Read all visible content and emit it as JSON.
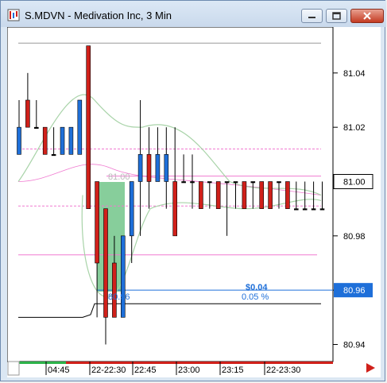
{
  "window": {
    "title": "S.MDVN - Medivation Inc, 3 Min",
    "minimize_icon": "minimize-icon",
    "restore_icon": "restore-icon",
    "close_icon": "close-icon"
  },
  "colors": {
    "bull": "#1e6fd9",
    "bear": "#d0201a",
    "neutral": "#000000",
    "price_marker_bg": "#1e6fd9",
    "band": "#a8d3a8",
    "zone": "#5fbe7a",
    "pink": "#f07ad0"
  },
  "price_axis": {
    "ticks": [
      "81.04",
      "81.02",
      "81.00",
      "80.98",
      "80.96",
      "80.94"
    ],
    "current_price": "81.00",
    "marker_price": "80.96"
  },
  "time_axis": {
    "labels": [
      "04:45",
      "22-22:30",
      "22:45",
      "23:00",
      "23:15",
      "22-23:30"
    ]
  },
  "annotations": {
    "price_change": "$0.04",
    "percent_change": "0.05 %",
    "zone_low_label": "80.96",
    "zone_high_label": "81.00"
  },
  "chart_data": {
    "type": "ohlc",
    "y_range": [
      80.934,
      81.054
    ],
    "bars": [
      {
        "o": 81.01,
        "h": 81.03,
        "l": 81.01,
        "c": 81.02
      },
      {
        "o": 81.03,
        "h": 81.04,
        "l": 81.02,
        "c": 81.02
      },
      {
        "o": 81.02,
        "h": 81.03,
        "l": 81.02,
        "c": 81.02
      },
      {
        "o": 81.02,
        "h": 81.02,
        "l": 81.01,
        "c": 81.01
      },
      {
        "o": 81.01,
        "h": 81.02,
        "l": 81.01,
        "c": 81.01
      },
      {
        "o": 81.01,
        "h": 81.02,
        "l": 81.01,
        "c": 81.02
      },
      {
        "o": 81.01,
        "h": 81.02,
        "l": 81.01,
        "c": 81.02
      },
      {
        "o": 81.01,
        "h": 81.03,
        "l": 81.01,
        "c": 81.03
      },
      {
        "o": 81.05,
        "h": 81.05,
        "l": 81.0,
        "c": 80.99
      },
      {
        "o": 81.0,
        "h": 81.0,
        "l": 80.95,
        "c": 80.97
      },
      {
        "o": 80.99,
        "h": 80.99,
        "l": 80.94,
        "c": 80.95
      },
      {
        "o": 80.97,
        "h": 80.98,
        "l": 80.95,
        "c": 80.95
      },
      {
        "o": 80.95,
        "h": 80.98,
        "l": 80.95,
        "c": 80.98
      },
      {
        "o": 80.98,
        "h": 81.0,
        "l": 80.97,
        "c": 81.0
      },
      {
        "o": 81.0,
        "h": 81.03,
        "l": 80.98,
        "c": 81.01
      },
      {
        "o": 81.01,
        "h": 81.02,
        "l": 80.99,
        "c": 81.0
      },
      {
        "o": 81.0,
        "h": 81.02,
        "l": 81.0,
        "c": 81.01
      },
      {
        "o": 81.0,
        "h": 81.02,
        "l": 80.99,
        "c": 81.01
      },
      {
        "o": 81.0,
        "h": 81.02,
        "l": 80.98,
        "c": 80.98
      },
      {
        "o": 81.0,
        "h": 81.01,
        "l": 81.0,
        "c": 81.0
      },
      {
        "o": 81.0,
        "h": 81.01,
        "l": 80.99,
        "c": 81.0
      },
      {
        "o": 81.0,
        "h": 81.0,
        "l": 80.99,
        "c": 80.99
      },
      {
        "o": 81.0,
        "h": 81.0,
        "l": 80.99,
        "c": 81.0
      },
      {
        "o": 81.0,
        "h": 81.0,
        "l": 80.99,
        "c": 80.99
      },
      {
        "o": 81.0,
        "h": 81.0,
        "l": 80.98,
        "c": 81.0
      },
      {
        "o": 81.0,
        "h": 81.0,
        "l": 80.99,
        "c": 81.0
      },
      {
        "o": 81.0,
        "h": 81.0,
        "l": 80.99,
        "c": 80.99
      },
      {
        "o": 81.0,
        "h": 81.0,
        "l": 80.99,
        "c": 81.0
      },
      {
        "o": 81.0,
        "h": 81.0,
        "l": 80.99,
        "c": 80.99
      },
      {
        "o": 81.0,
        "h": 81.0,
        "l": 80.99,
        "c": 80.99
      },
      {
        "o": 81.0,
        "h": 81.0,
        "l": 80.99,
        "c": 81.0
      },
      {
        "o": 81.0,
        "h": 81.0,
        "l": 80.99,
        "c": 80.99
      },
      {
        "o": 80.99,
        "h": 81.0,
        "l": 80.99,
        "c": 80.99
      },
      {
        "o": 80.99,
        "h": 81.0,
        "l": 80.99,
        "c": 80.99
      },
      {
        "o": 80.99,
        "h": 81.0,
        "l": 80.99,
        "c": 80.99
      },
      {
        "o": 80.99,
        "h": 81.0,
        "l": 80.99,
        "c": 80.99
      }
    ]
  }
}
